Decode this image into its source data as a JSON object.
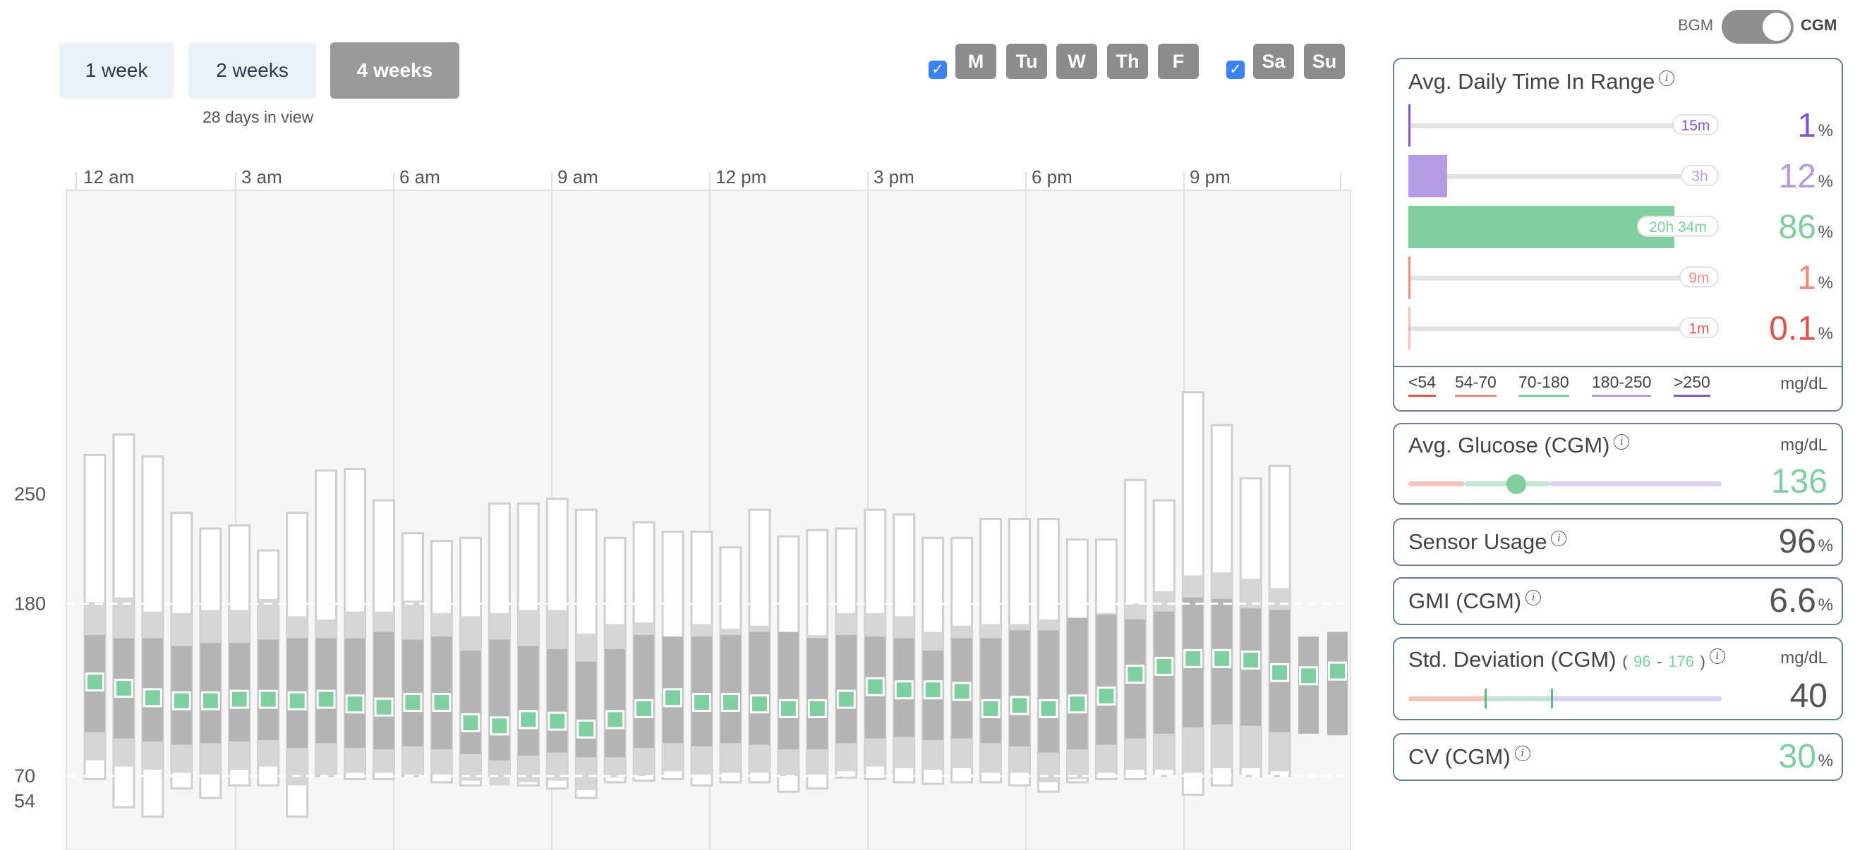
{
  "range_buttons": [
    {
      "label": "1 week",
      "active": false
    },
    {
      "label": "2 weeks",
      "active": false
    },
    {
      "label": "4 weeks",
      "active": true
    }
  ],
  "days_in_view": "28 days in view",
  "weekdays": [
    "M",
    "Tu",
    "W",
    "Th",
    "F"
  ],
  "weekend": [
    "Sa",
    "Su"
  ],
  "weekdays_checked": true,
  "weekend_checked": true,
  "toggle": {
    "left": "BGM",
    "right": "CGM",
    "selected": "CGM"
  },
  "colors": {
    "very_low": "#e0524b",
    "low": "#ee8a7f",
    "target": "#7fcfa0",
    "high": "#b39ce4",
    "very_high": "#7e57d6",
    "box_median": "#7fcfa0",
    "panel_border": "#6b7c93",
    "checkbox": "#3b82f6"
  },
  "chart_data": {
    "type": "box",
    "x_tick_labels": [
      "12 am",
      "3 am",
      "6 am",
      "9 am",
      "12 pm",
      "3 pm",
      "6 pm",
      "9 pm"
    ],
    "y_tick_labels": [
      "250",
      "180",
      "70",
      "54"
    ],
    "y_ticks": [
      250,
      180,
      70,
      54
    ],
    "ylim": [
      0,
      450
    ],
    "target_range_lines": [
      180,
      70
    ],
    "intervals_per_day": 48,
    "interval_minutes": 30,
    "series": {
      "max": [
        275,
        288,
        274,
        238,
        228,
        230,
        214,
        238,
        265,
        266,
        246,
        225,
        220,
        222,
        244,
        244,
        247,
        240,
        222,
        232,
        226,
        226,
        216,
        240,
        223,
        227,
        228,
        240,
        237,
        222,
        222,
        234,
        234,
        234,
        221,
        221,
        259,
        246,
        315,
        294,
        260,
        268
      ],
      "p90": [
        181,
        184,
        175,
        174,
        176,
        176,
        183,
        172,
        170,
        175,
        175,
        182,
        174,
        172,
        174,
        176,
        176,
        161,
        167,
        168,
        159,
        167,
        164,
        166,
        160,
        160,
        174,
        174,
        172,
        162,
        166,
        167,
        167,
        170,
        171,
        174,
        180,
        188,
        198,
        200,
        196,
        190
      ],
      "p75": [
        160,
        158,
        158,
        153,
        155,
        155,
        157,
        158,
        158,
        158,
        162,
        157,
        159,
        150,
        157,
        153,
        151,
        143,
        151,
        160,
        159,
        159,
        160,
        162,
        162,
        158,
        160,
        159,
        158,
        150,
        158,
        158,
        163,
        163,
        171,
        173,
        170,
        175,
        184,
        183,
        177,
        176
      ],
      "median": [
        130,
        126,
        120,
        118,
        118,
        119,
        119,
        118,
        119,
        116,
        114,
        117,
        117,
        104,
        102,
        106,
        105,
        100,
        106,
        113,
        120,
        117,
        117,
        116,
        113,
        113,
        119,
        127,
        125,
        125,
        124,
        113,
        115,
        113,
        116,
        121,
        135,
        140,
        145,
        145,
        144,
        136,
        134,
        137
      ],
      "p25": [
        98,
        94,
        92,
        90,
        91,
        92,
        93,
        88,
        91,
        88,
        87,
        89,
        87,
        84,
        80,
        83,
        85,
        82,
        82,
        88,
        91,
        89,
        91,
        90,
        87,
        87,
        91,
        94,
        95,
        93,
        94,
        91,
        89,
        85,
        87,
        90,
        94,
        97,
        101,
        103,
        102,
        98,
        97,
        96
      ],
      "p10": [
        80,
        76,
        74,
        72,
        71,
        74,
        76,
        64,
        70,
        72,
        72,
        71,
        71,
        67,
        64,
        66,
        67,
        61,
        69,
        70,
        73,
        71,
        72,
        72,
        70,
        71,
        73,
        76,
        75,
        74,
        75,
        72,
        72,
        66,
        68,
        72,
        74,
        74,
        72,
        75,
        75,
        73,
        76,
        76
      ],
      "min": [
        68,
        50,
        44,
        62,
        56,
        64,
        64,
        44,
        70,
        68,
        68,
        70,
        66,
        64,
        70,
        64,
        62,
        56,
        66,
        67,
        68,
        64,
        66,
        66,
        60,
        62,
        69,
        68,
        66,
        65,
        66,
        66,
        64,
        60,
        66,
        68,
        68,
        70,
        58,
        64,
        70,
        70,
        76,
        76
      ]
    }
  },
  "time_in_range": {
    "title": "Avg. Daily Time In Range",
    "rows": [
      {
        "duration": "15m",
        "percent": "1",
        "fraction": 0.01,
        "color_key": "very_high"
      },
      {
        "duration": "3h",
        "percent": "12",
        "fraction": 0.125,
        "color_key": "high"
      },
      {
        "duration": "20h 34m",
        "percent": "86",
        "fraction": 0.857,
        "color_key": "target"
      },
      {
        "duration": "9m",
        "percent": "1",
        "fraction": 0.006,
        "color_key": "low"
      },
      {
        "duration": "1m",
        "percent": "0.1",
        "fraction": 0.001,
        "color_key": "very_low"
      }
    ],
    "legend": [
      {
        "label": "<54",
        "color_key": "very_low"
      },
      {
        "label": "54-70",
        "color_key": "low"
      },
      {
        "label": "70-180",
        "color_key": "target"
      },
      {
        "label": "180-250",
        "color_key": "high"
      },
      {
        "label": ">250",
        "color_key": "very_high"
      }
    ],
    "unit": "mg/dL",
    "percent_sign": "%"
  },
  "avg_glucose": {
    "title": "Avg. Glucose (CGM)",
    "unit": "mg/dL",
    "value": "136"
  },
  "sensor_usage": {
    "title": "Sensor Usage",
    "value": "96",
    "percent_sign": "%"
  },
  "gmi": {
    "title": "GMI (CGM)",
    "value": "6.6",
    "percent_sign": "%"
  },
  "std_dev": {
    "title": "Std. Deviation (CGM)",
    "range_open": "(",
    "range_low": "96",
    "range_dash": "-",
    "range_high": "176",
    "range_close": ")",
    "unit": "mg/dL",
    "value": "40"
  },
  "cv": {
    "title": "CV (CGM)",
    "value": "30",
    "percent_sign": "%"
  }
}
